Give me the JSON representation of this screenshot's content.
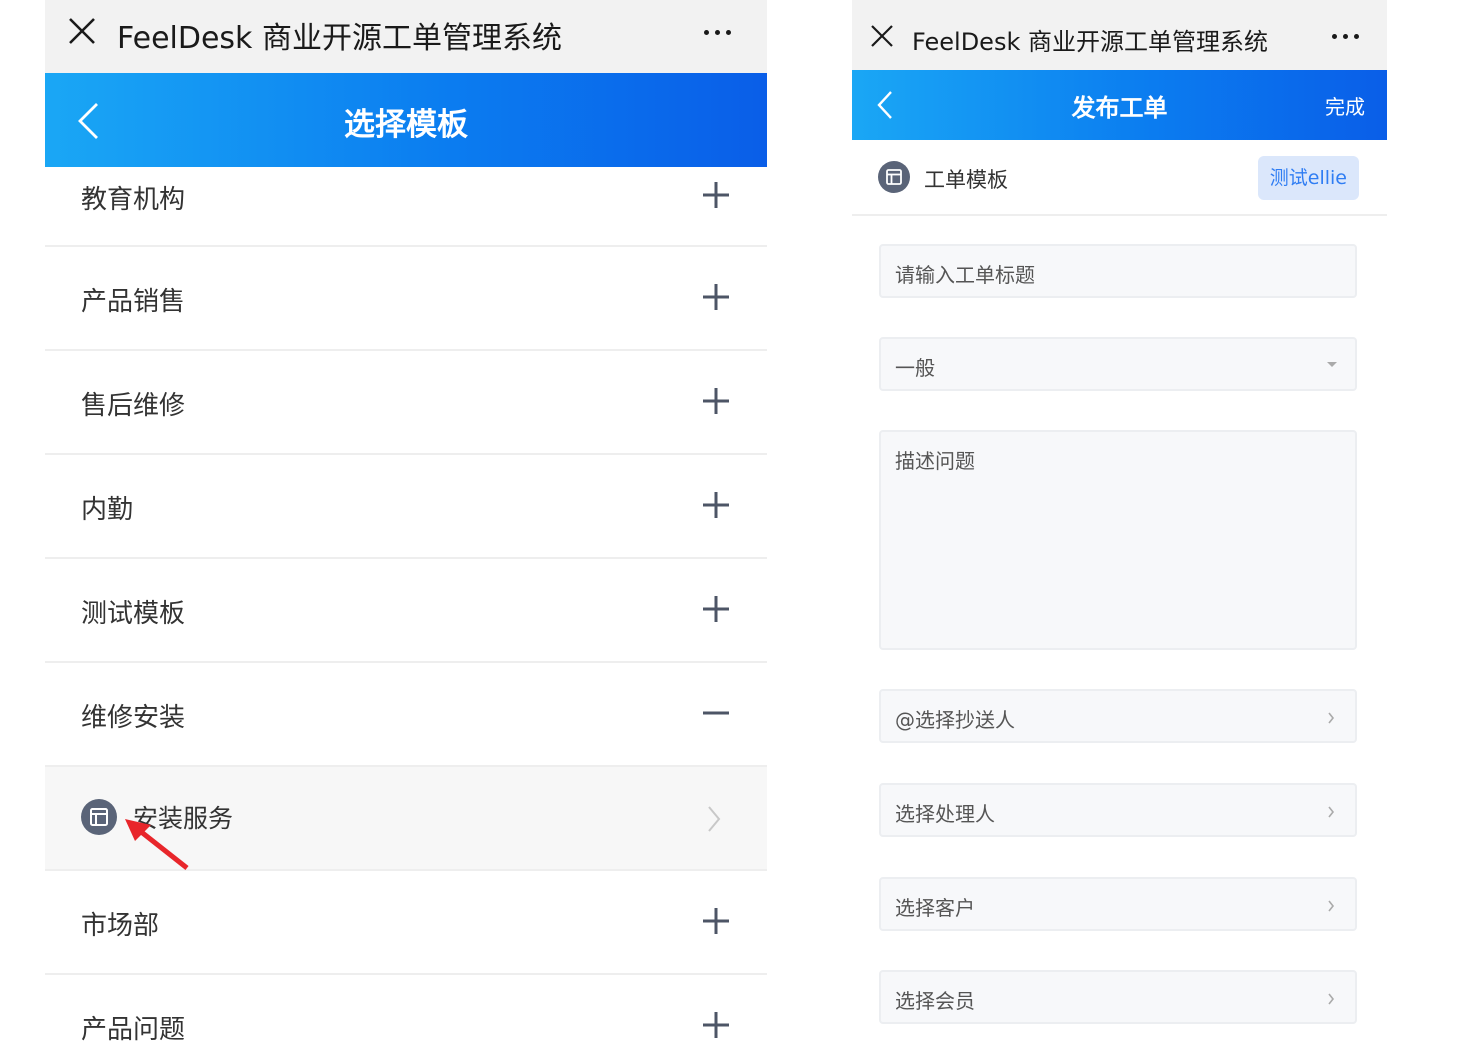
{
  "app_title": "FeelDesk 商业开源工单管理系统",
  "left": {
    "nav_title": "选择模板",
    "categories": [
      {
        "label": "教育机构",
        "state": "collapsed"
      },
      {
        "label": "产品销售",
        "state": "collapsed"
      },
      {
        "label": "售后维修",
        "state": "collapsed"
      },
      {
        "label": "内勤",
        "state": "collapsed"
      },
      {
        "label": "测试模板",
        "state": "collapsed"
      },
      {
        "label": "维修安装",
        "state": "expanded"
      }
    ],
    "sub_item": {
      "label": "安装服务",
      "icon": "template-icon"
    },
    "categories_after": [
      {
        "label": "市场部",
        "state": "collapsed"
      },
      {
        "label": "产品问题",
        "state": "collapsed"
      }
    ]
  },
  "right": {
    "nav_title": "发布工单",
    "done_label": "完成",
    "template_label": "工单模板",
    "template_badge": "测试ellie",
    "title_placeholder": "请输入工单标题",
    "priority_value": "一般",
    "description_placeholder": "描述问题",
    "cc_label": "@选择抄送人",
    "handler_label": "选择处理人",
    "customer_label": "选择客户",
    "member_label": "选择会员"
  },
  "colors": {
    "nav_gradient_start": "#1aa7f5",
    "nav_gradient_end": "#0a5ee8",
    "badge_bg": "#dbe7fb",
    "badge_text": "#2f7df3",
    "annotation_arrow": "#e8262b"
  }
}
